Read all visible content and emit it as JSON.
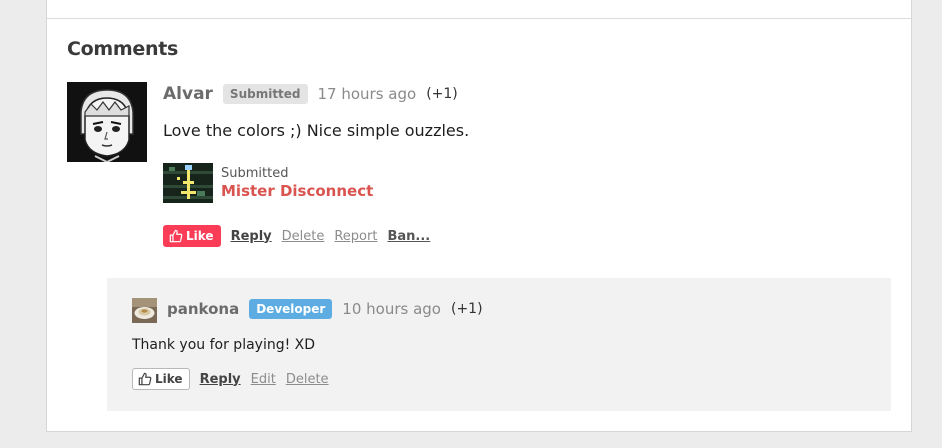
{
  "comments_section": {
    "title": "Comments"
  },
  "comment": {
    "author": "Alvar",
    "badge": "Submitted",
    "time": "17 hours ago",
    "score": "(+1)",
    "body": "Love the colors ;) Nice simple ouzzles.",
    "submission": {
      "label": "Submitted",
      "title": "Mister Disconnect"
    },
    "actions": {
      "like": "Like",
      "reply": "Reply",
      "delete": "Delete",
      "report": "Report",
      "ban": "Ban..."
    }
  },
  "reply": {
    "author": "pankona",
    "badge": "Developer",
    "time": "10 hours ago",
    "score": "(+1)",
    "body": "Thank you for playing! XD",
    "actions": {
      "like": "Like",
      "reply": "Reply",
      "edit": "Edit",
      "delete": "Delete"
    }
  },
  "colors": {
    "like_active": "#fa3c56",
    "developer_badge": "#5dade2",
    "game_title": "#d9534f"
  }
}
